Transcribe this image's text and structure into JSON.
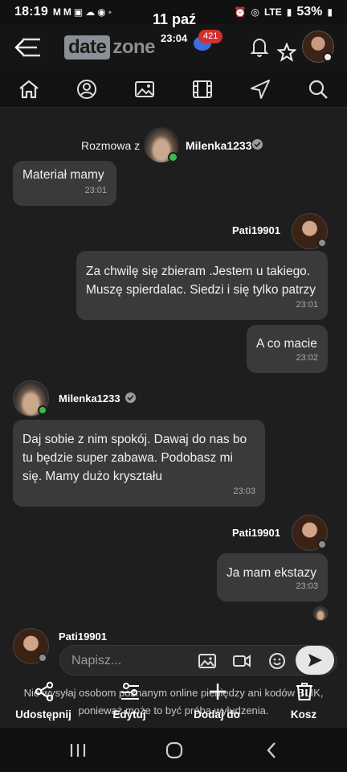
{
  "status_bar": {
    "time": "18:19",
    "notifications": [
      "M",
      "M"
    ],
    "network": "LTE",
    "battery": "53%"
  },
  "header": {
    "logo_date": "date",
    "logo_zone": "zone",
    "overlay_date": "11 paź",
    "overlay_time": "23:04",
    "badge_count": "421"
  },
  "conversation": {
    "prefix": "Rozmowa z",
    "partner_name": "Milenka1233"
  },
  "messages": [
    {
      "text": "Materiał mamy",
      "time": "23:01"
    },
    {
      "sender": "Pati19901",
      "text": "Za chwilę się zbieram .Jestem u takiego. Muszę spierdalac. Siedzi i się tylko patrzy",
      "time": "23:01"
    },
    {
      "text": "A co macie",
      "time": "23:02"
    },
    {
      "sender": "Milenka1233",
      "text": "Daj sobie z nim spokój. Dawaj do nas bo tu będzie super zabawa. Podobasz mi się. Mamy dużo kryształu",
      "time": "23:03"
    },
    {
      "sender": "Pati19901",
      "text": "Ja mam ekstazy",
      "time": "23:03"
    }
  ],
  "compose": {
    "sender": "Pati19901",
    "placeholder": "Napisz..."
  },
  "warning": {
    "line1": "Nie wysyłaj osobom poznanym online pieniędzy ani kodów BLIK,",
    "line2": "ponieważ może to być próba wyłudzenia."
  },
  "actions": {
    "share": "Udostępnij",
    "edit": "Edytuj",
    "add": "Dodaj do",
    "trash": "Kosz"
  }
}
